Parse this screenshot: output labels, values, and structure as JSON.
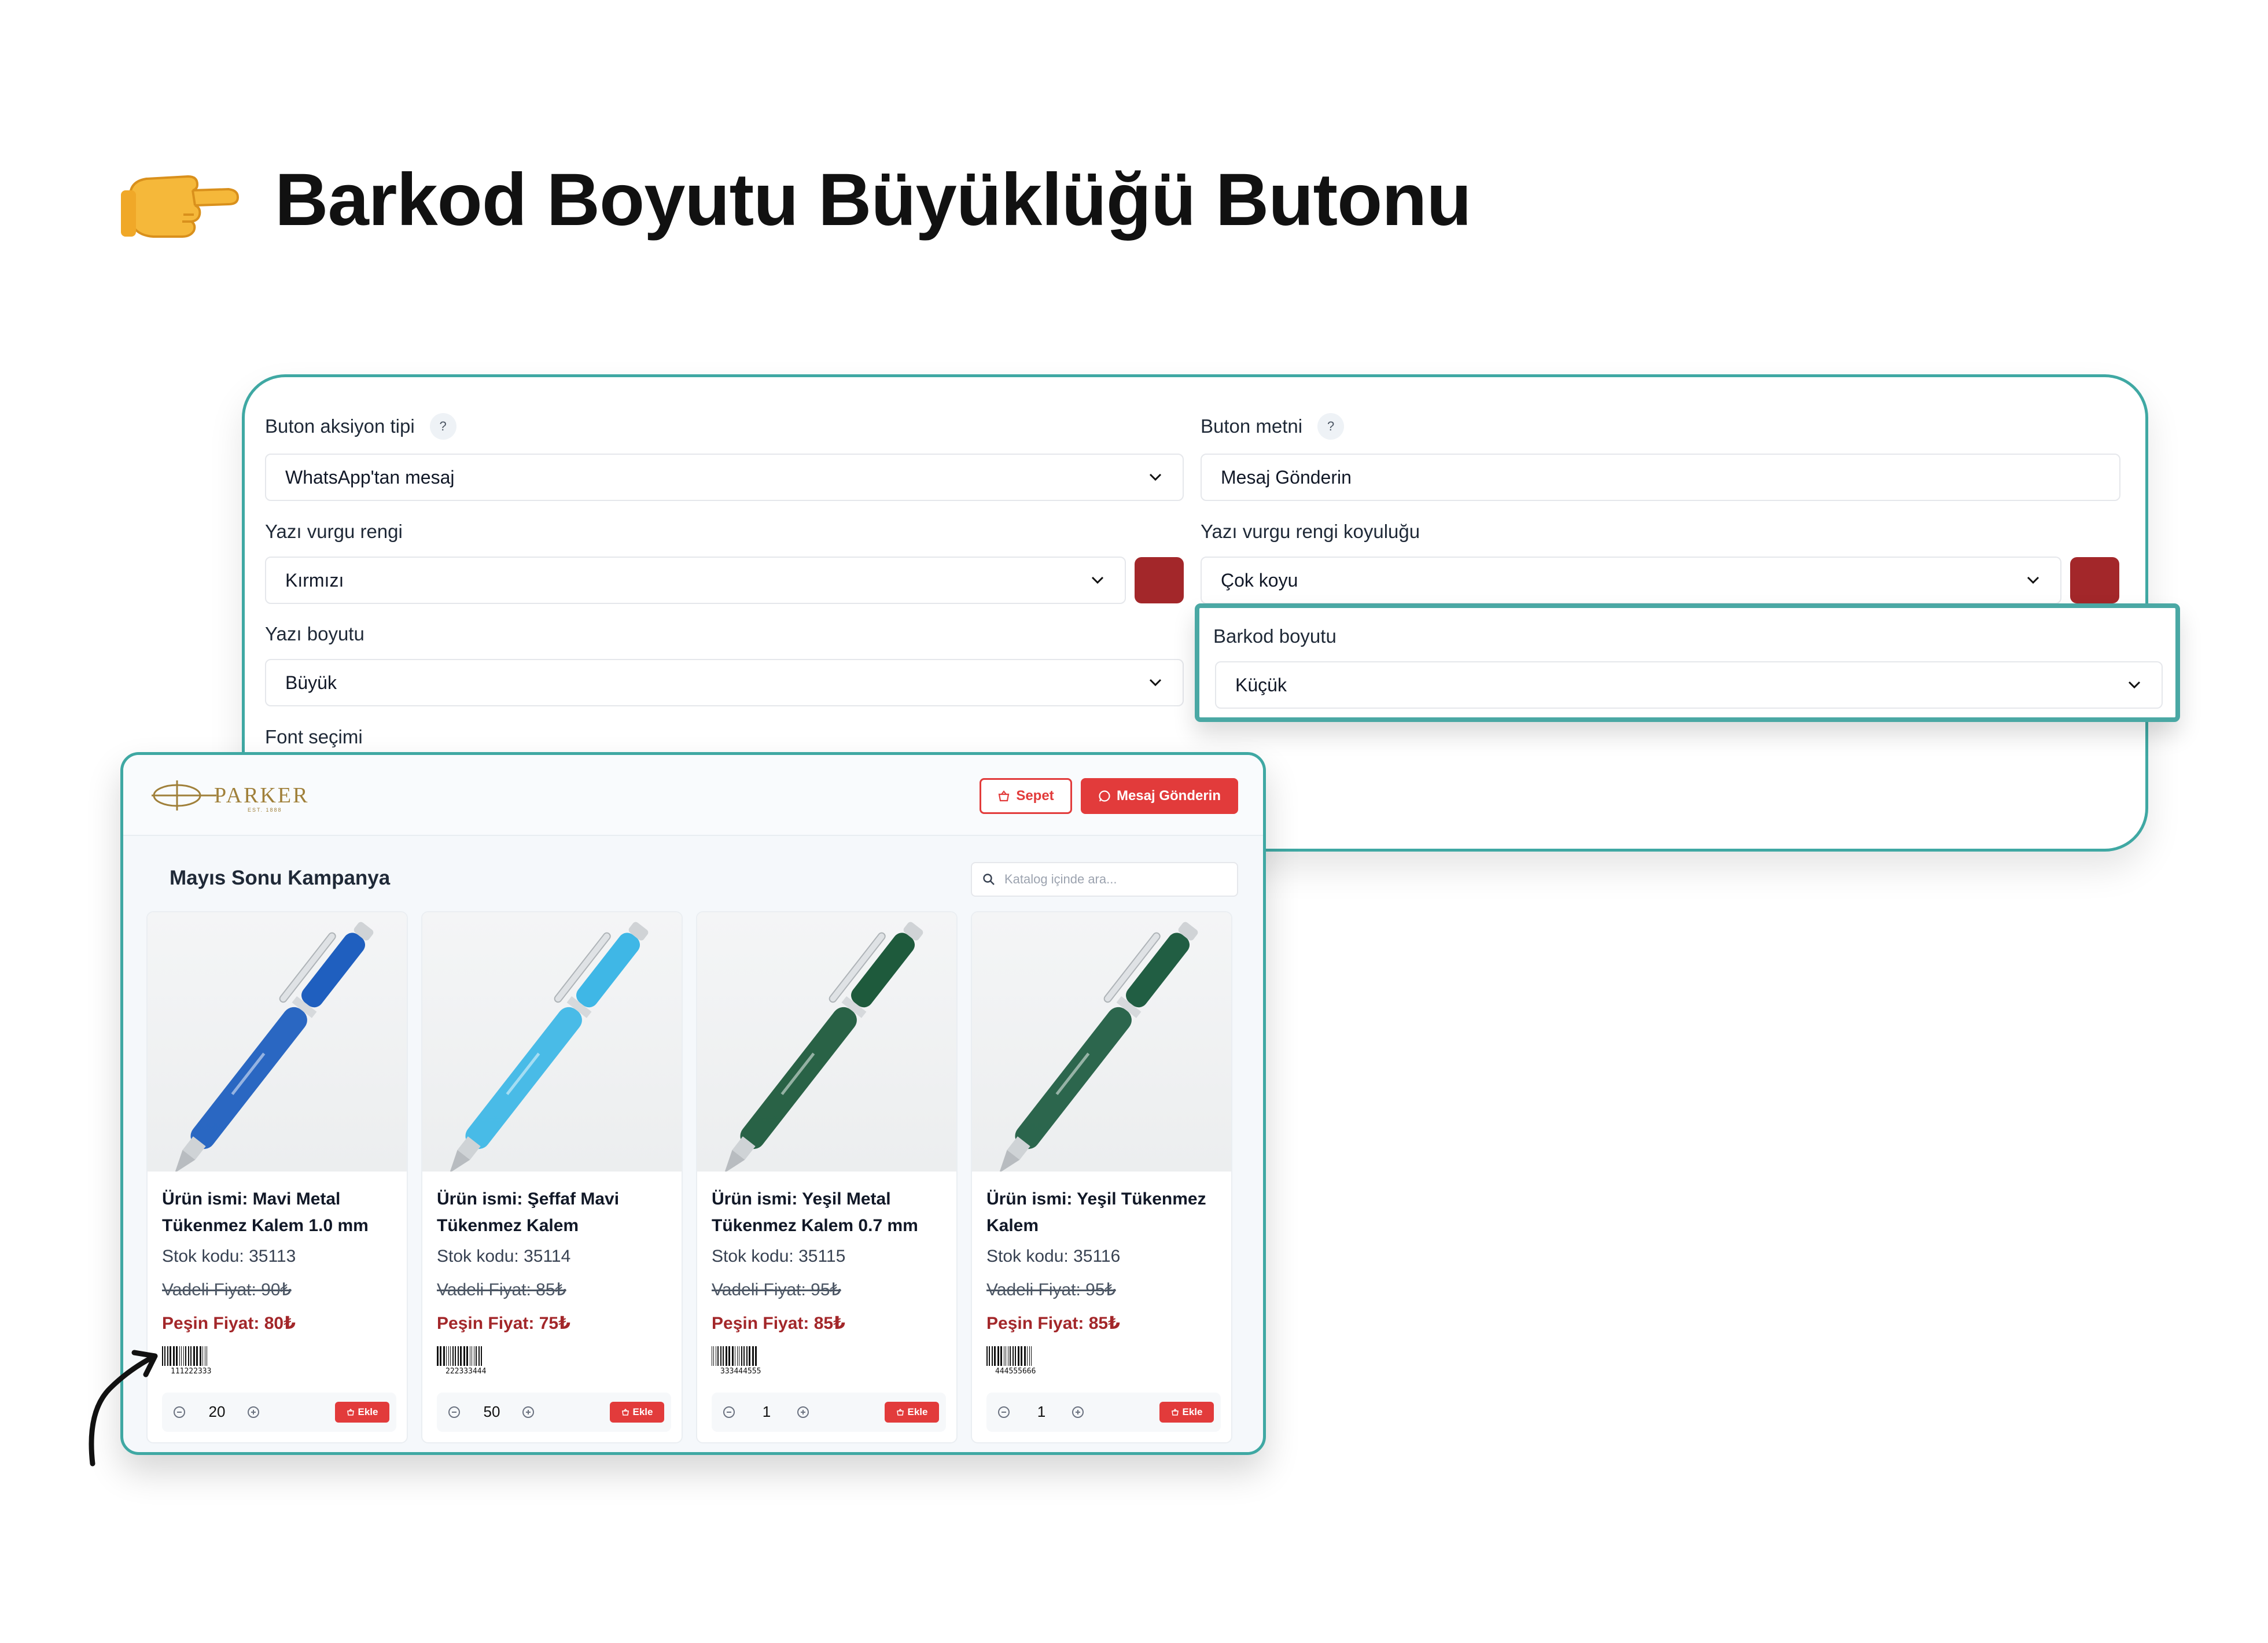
{
  "heading": {
    "title": "Barkod Boyutu Büyüklüğü Butonu",
    "icon": "pointing-hand-icon"
  },
  "settings": {
    "button_action_type": {
      "label": "Buton aksiyon tipi",
      "help": "?",
      "value": "WhatsApp'tan mesaj"
    },
    "button_text": {
      "label": "Buton metni",
      "help": "?",
      "value": "Mesaj Gönderin"
    },
    "accent_color": {
      "label": "Yazı vurgu rengi",
      "value": "Kırmızı",
      "swatch": "#a3272a"
    },
    "accent_shade": {
      "label": "Yazı vurgu rengi koyuluğu",
      "value": "Çok koyu",
      "swatch": "#a3272a"
    },
    "font_size": {
      "label": "Yazı boyutu",
      "value": "Büyük"
    },
    "font_choice": {
      "label": "Font seçimi"
    },
    "barcode_size": {
      "label": "Barkod boyutu",
      "value": "Küçük"
    }
  },
  "catalog": {
    "brand": {
      "name": "PARKER",
      "sub": "EST. 1888"
    },
    "cart_button": "Sepet",
    "message_button": "Mesaj Gönderin",
    "title": "Mayıs Sonu Kampanya",
    "search_placeholder": "Katalog içinde ara...",
    "add_label": "Ekle",
    "products": [
      {
        "name": "Ürün ismi: Mavi Metal Tükenmez Kalem 1.0 mm",
        "code": "Stok kodu: 35113",
        "old_price": "Vadeli Fiyat: 90₺",
        "cash_price": "Peşin Fiyat: 80₺",
        "barcode": "111222333",
        "qty": "20",
        "color": "#1f5fbf"
      },
      {
        "name": "Ürün ismi: Şeffaf Mavi Tükenmez Kalem",
        "code": "Stok kodu: 35114",
        "old_price": "Vadeli Fiyat: 85₺",
        "cash_price": "Peşin Fiyat: 75₺",
        "barcode": "222333444",
        "qty": "50",
        "color": "#3fb7e6"
      },
      {
        "name": "Ürün ismi: Yeşil Metal Tükenmez Kalem 0.7 mm",
        "code": "Stok kodu: 35115",
        "old_price": "Vadeli Fiyat: 95₺",
        "cash_price": "Peşin Fiyat: 85₺",
        "barcode": "333444555",
        "qty": "1",
        "color": "#1e5a3c"
      },
      {
        "name": "Ürün ismi: Yeşil Tükenmez Kalem",
        "code": "Stok kodu: 35116",
        "old_price": "Vadeli Fiyat: 95₺",
        "cash_price": "Peşin Fiyat: 85₺",
        "barcode": "444555666",
        "qty": "1",
        "color": "#215e43"
      }
    ]
  }
}
